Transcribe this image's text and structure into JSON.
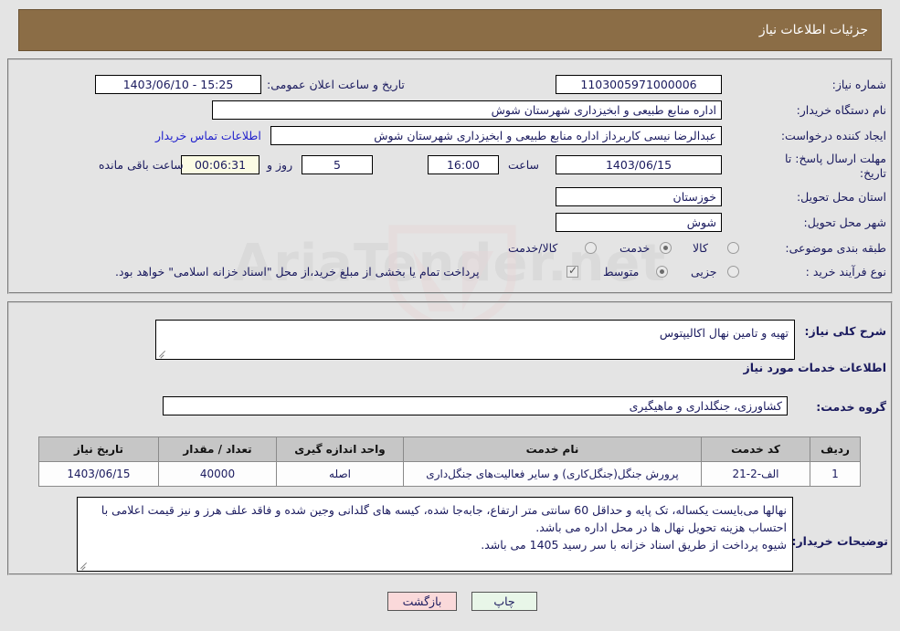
{
  "header": {
    "title": "جزئیات اطلاعات نیاز"
  },
  "form": {
    "need_number": {
      "label": "شماره نیاز:",
      "value": "1103005971000006"
    },
    "announce_datetime": {
      "label": "تاریخ و ساعت اعلان عمومی:",
      "value": "15:25 - 1403/06/10"
    },
    "buyer_org": {
      "label": "نام دستگاه خریدار:",
      "value": "اداره منابع طبیعی و ابخیزداری شهرستان شوش"
    },
    "request_creator": {
      "label": "ایجاد کننده درخواست:",
      "value": "عبدالرضا نیسی کاربرداز اداره منابع طبیعی و ابخیزداری شهرستان شوش"
    },
    "buyer_contact_link": "اطلاعات تماس خریدار",
    "deadline": {
      "label_line1": "مهلت ارسال پاسخ: تا",
      "label_line2": "تاریخ:",
      "date": "1403/06/15",
      "hour_label": "ساعت",
      "time": "16:00",
      "days_remaining": "5",
      "days_label": "روز و",
      "countdown": "00:06:31",
      "remaining_label": "ساعت باقی مانده"
    },
    "province": {
      "label": "استان محل تحویل:",
      "value": "خوزستان"
    },
    "city": {
      "label": "شهر محل تحویل:",
      "value": "شوش"
    },
    "subject_category": {
      "label": "طبقه بندی موضوعی:",
      "options": [
        "کالا",
        "خدمت",
        "کالا/خدمت"
      ],
      "selected": "خدمت"
    },
    "purchase_process": {
      "label": "نوع فرآیند خرید :",
      "options": [
        "جزیی",
        "متوسط"
      ],
      "selected": "متوسط"
    },
    "treasury_note": "پرداخت تمام یا بخشی از مبلغ خرید،از محل \"اسناد خزانه اسلامی\" خواهد بود."
  },
  "details": {
    "general_description": {
      "label": "شرح کلی نیاز:",
      "value": "تهیه و تامین نهال اکالیپتوس"
    },
    "services_heading": "اطلاعات خدمات مورد نیاز",
    "service_group": {
      "label": "گروه خدمت:",
      "value": "کشاورزی، جنگلداری و ماهیگیری"
    },
    "table": {
      "headers": [
        "ردیف",
        "کد خدمت",
        "نام خدمت",
        "واحد اندازه گیری",
        "تعداد / مقدار",
        "تاریخ نیاز"
      ],
      "rows": [
        [
          "1",
          "الف-2-21",
          "پرورش جنگل(جنگل‌کاری) و سایر فعالیت‌های جنگل‌داری",
          "اصله",
          "40000",
          "1403/06/15"
        ]
      ]
    },
    "buyer_notes": {
      "label": "توضیحات خریدار:",
      "lines": [
        "نهالها می‌بایست یکساله، تک پایه و حداقل 60 سانتی متر ارتفاع، جابه‌جا شده، کیسه های گلدانی وجین شده و فاقد علف هرز و نیز قیمت اعلامی  با احتساب هزینه تحویل نهال ها  در محل اداره می باشد.",
        "شیوه پرداخت از طریق اسناد خزانه با سر رسید 1405 می باشد."
      ]
    }
  },
  "footer": {
    "print_label": "چاپ",
    "back_label": "بازگشت"
  }
}
